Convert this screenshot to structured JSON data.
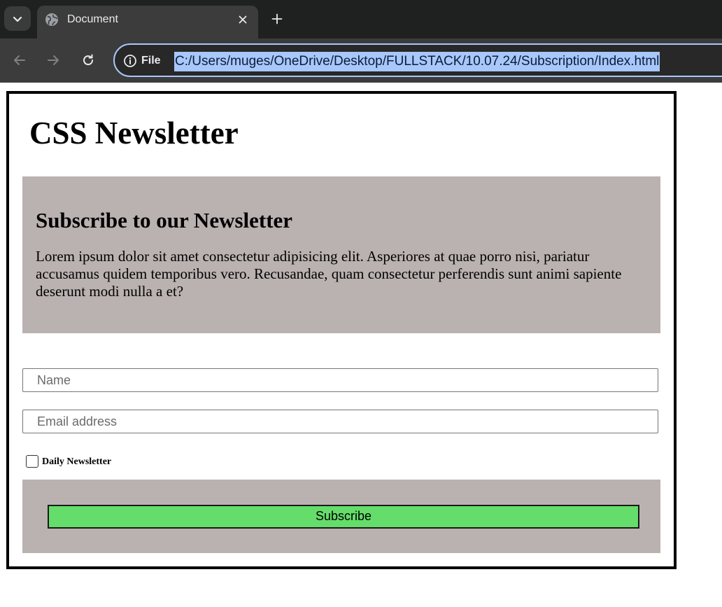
{
  "browser": {
    "tab": {
      "title": "Document"
    },
    "site_chip_label": "File",
    "url": "C:/Users/muges/OneDrive/Desktop/FULLSTACK/10.07.24/Subscription/Index.html",
    "colors": {
      "tabbar_bg": "#1f2020",
      "toolbar_bg": "#3c3c3c",
      "url_highlight": "#a8c7fa"
    }
  },
  "page": {
    "title": "CSS Newsletter",
    "intro": {
      "heading": "Subscribe to our Newsletter",
      "text": "Lorem ipsum dolor sit amet consectetur adipisicing elit. Asperiores at quae porro nisi, pariatur accusamus quidem temporibus vero. Recusandae, quam consectetur perferendis sunt animi sapiente deserunt modi nulla a et?"
    },
    "form": {
      "name_placeholder": "Name",
      "name_value": "",
      "email_placeholder": "Email address",
      "email_value": "",
      "checkbox_label": "Daily Newsletter",
      "checkbox_checked": false,
      "subscribe_label": "Subscribe"
    },
    "colors": {
      "panel_bg": "#bab1b1",
      "button_bg": "#64dd6a",
      "border": "#000000"
    }
  }
}
